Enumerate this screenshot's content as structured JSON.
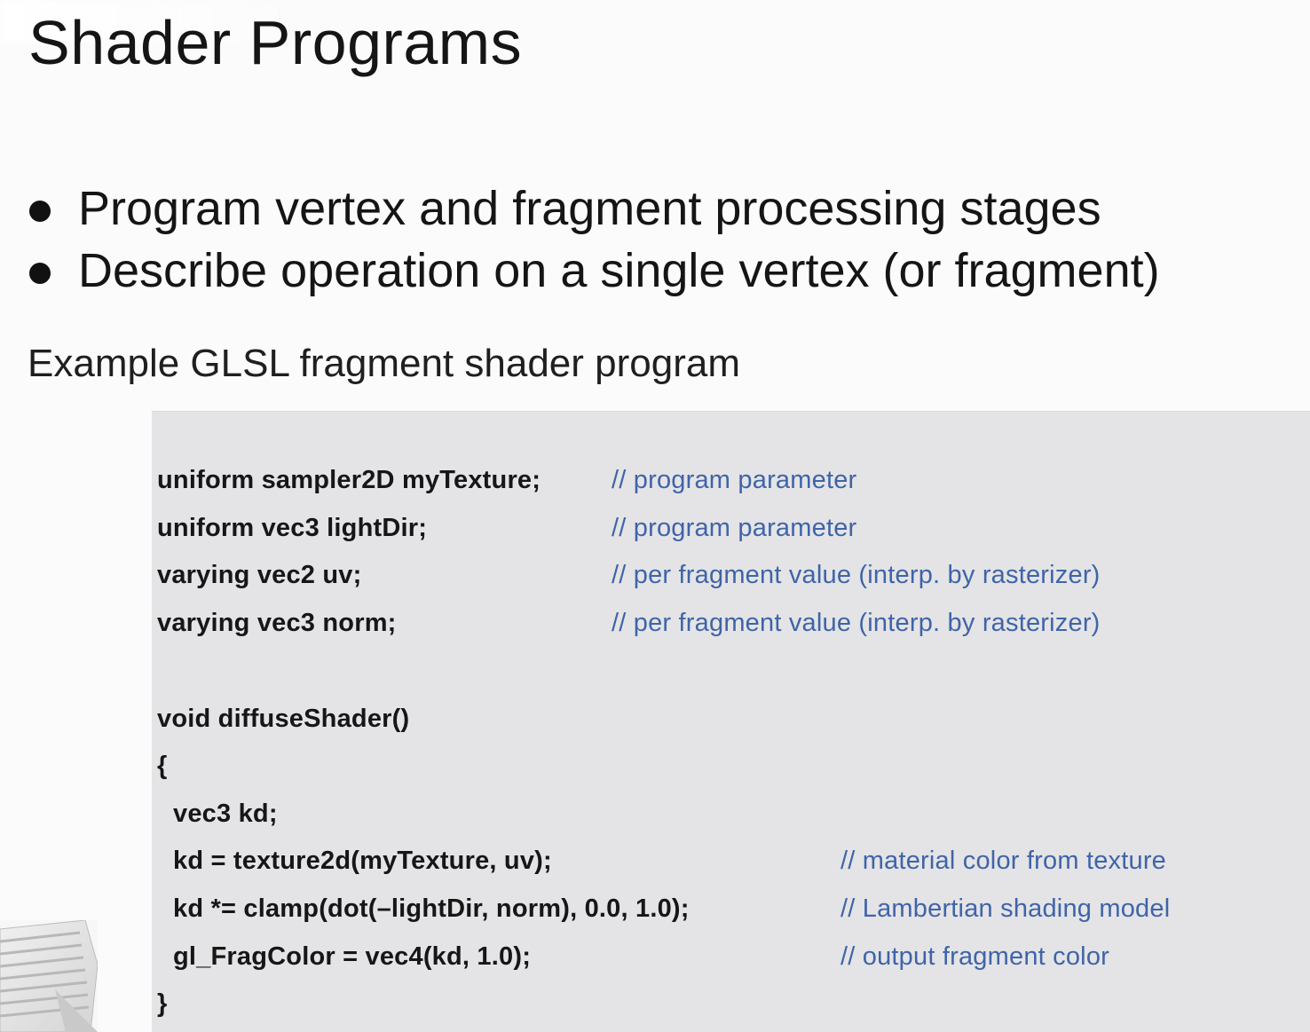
{
  "slide": {
    "title": "Shader Programs",
    "bullets": [
      "Program vertex and fragment processing stages",
      "Describe operation on a single vertex (or fragment)"
    ],
    "subheading": "Example GLSL fragment shader program"
  },
  "code": {
    "lines": [
      {
        "code": "uniform sampler2D myTexture;",
        "comment": "// program parameter"
      },
      {
        "code": "uniform vec3 lightDir;",
        "comment": "// program parameter"
      },
      {
        "code": "varying vec2 uv;",
        "comment": "// per fragment value (interp. by rasterizer)"
      },
      {
        "code": "varying vec3 norm;",
        "comment": "// per fragment value (interp. by rasterizer)"
      },
      {
        "code": "void diffuseShader()",
        "comment": ""
      },
      {
        "code": "{",
        "comment": ""
      },
      {
        "code": "vec3 kd;",
        "comment": ""
      },
      {
        "code": "kd = texture2d(myTexture, uv);",
        "comment": "// material color from texture"
      },
      {
        "code": "kd *= clamp(dot(–lightDir, norm), 0.0, 1.0);",
        "comment": "// Lambertian shading model"
      },
      {
        "code": "gl_FragColor = vec4(kd, 1.0);",
        "comment": "// output fragment color"
      },
      {
        "code": "}",
        "comment": ""
      }
    ]
  },
  "colors": {
    "background": "#fbfbfb",
    "code_background": "#e4e4e6",
    "comment_blue": "#3f64a8",
    "text": "#151515"
  }
}
